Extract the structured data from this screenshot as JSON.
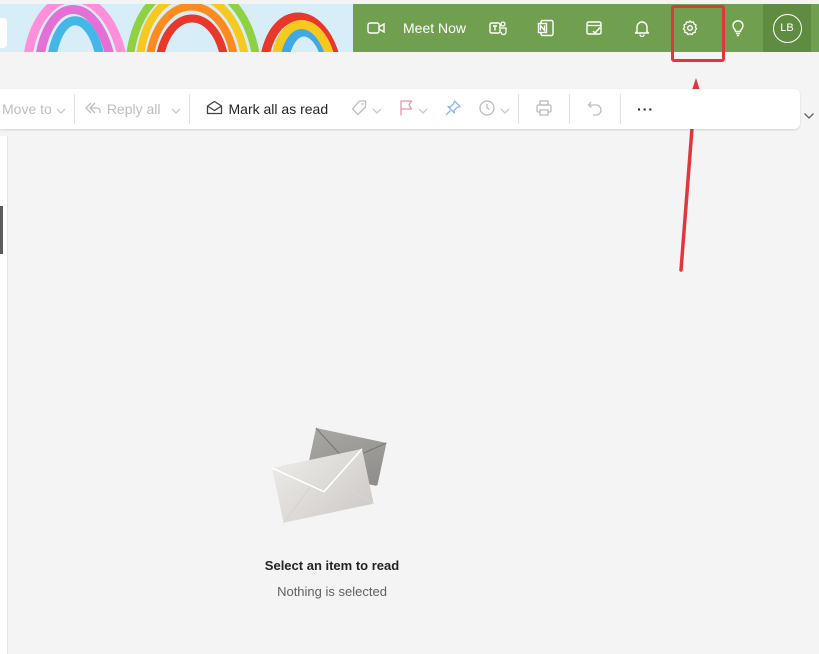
{
  "topbar": {
    "meet_now_label": "Meet Now",
    "accent_color": "#6f9f4f",
    "icons": [
      "video-icon",
      "teams-icon",
      "onenote-icon",
      "todo-icon",
      "bell-icon",
      "gear-icon",
      "lightbulb-icon"
    ],
    "avatar_initials": "LB"
  },
  "annotation": {
    "highlight_color": "#e0373f",
    "highlighted_item": "gear-icon"
  },
  "toolbar": {
    "move_to_label": "Move to",
    "reply_all_label": "Reply all",
    "mark_all_read_label": "Mark all as read",
    "more_label": "···"
  },
  "reading_pane": {
    "empty_title": "Select an item to read",
    "empty_subtitle": "Nothing is selected"
  }
}
